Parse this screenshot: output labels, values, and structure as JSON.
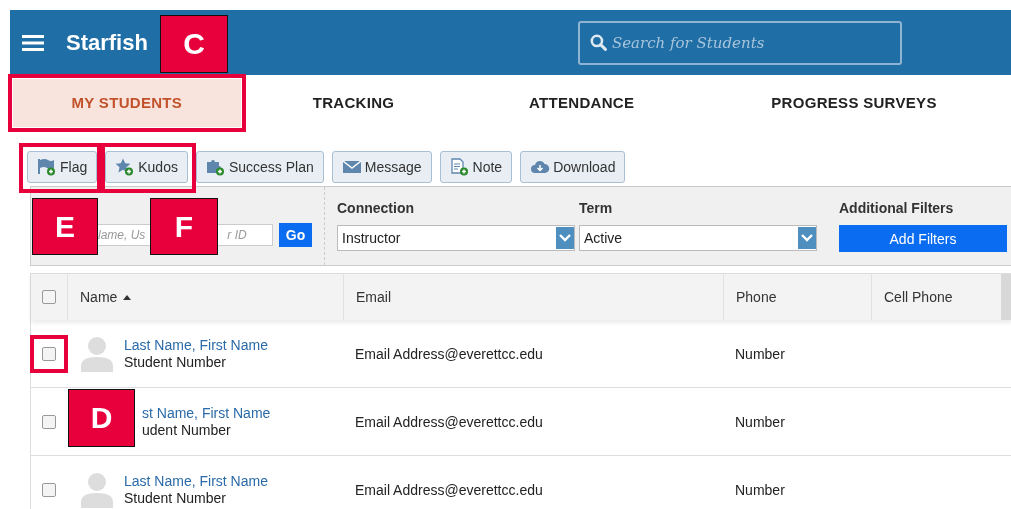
{
  "header": {
    "app_name": "Starfish",
    "search": {
      "placeholder": "Search for Students"
    }
  },
  "tabs": [
    {
      "label": "MY STUDENTS",
      "selected": true,
      "highlighted": true
    },
    {
      "label": "TRACKING",
      "selected": false,
      "highlighted": false
    },
    {
      "label": "ATTENDANCE",
      "selected": false,
      "highlighted": false
    },
    {
      "label": "PROGRESS SURVEYS",
      "selected": false,
      "highlighted": false
    }
  ],
  "toolbar": [
    {
      "label": "Flag",
      "kind": "flag",
      "highlighted": true
    },
    {
      "label": "Kudos",
      "kind": "star",
      "highlighted": true
    },
    {
      "label": "Success Plan",
      "kind": "puzzle",
      "highlighted": false
    },
    {
      "label": "Message",
      "kind": "envelope",
      "highlighted": false
    },
    {
      "label": "Note",
      "kind": "note",
      "highlighted": false
    },
    {
      "label": "Download",
      "kind": "cloud",
      "highlighted": false
    }
  ],
  "filters": {
    "search_fragments": [
      "lame, Us",
      "r ID"
    ],
    "go": "Go",
    "connection": {
      "label": "Connection",
      "value": "Instructor"
    },
    "term": {
      "label": "Term",
      "value": "Active"
    },
    "additional": {
      "label": "Additional Filters",
      "button": "Add Filters"
    }
  },
  "table": {
    "select_all": {
      "checked": false
    },
    "columns": [
      {
        "label": "Name",
        "sorted": true
      },
      {
        "label": "Email",
        "sorted": false
      },
      {
        "label": "Phone",
        "sorted": false
      },
      {
        "label": "Cell Phone",
        "sorted": false
      }
    ],
    "rows": [
      {
        "checked": false,
        "highlighted": true,
        "avatar": true,
        "name": "Last Name, First Name",
        "number": "Student Number",
        "email": "Email Address@everettcc.edu",
        "phone": "Number"
      },
      {
        "checked": false,
        "highlighted": false,
        "avatar": false,
        "name": "st Name, First Name",
        "number": "udent Number",
        "email": "Email Address@everettcc.edu",
        "phone": "Number"
      },
      {
        "checked": false,
        "highlighted": false,
        "avatar": true,
        "name": "Last Name, First Name",
        "number": "Student Number",
        "email": "Email Address@everettcc.edu",
        "phone": "Number"
      }
    ]
  },
  "callouts": [
    {
      "label": "C"
    },
    {
      "label": "E"
    },
    {
      "label": "F"
    },
    {
      "label": "D"
    }
  ]
}
